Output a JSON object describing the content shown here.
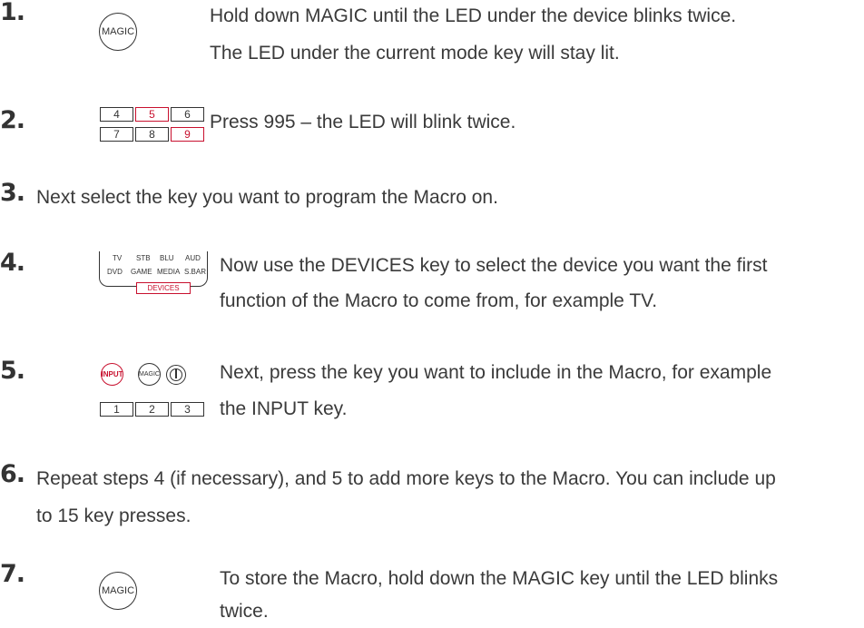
{
  "steps": [
    {
      "number": "1.",
      "lines": [
        "Hold down MAGIC until the LED under the device blinks twice.",
        "The LED under the current mode key will stay lit."
      ],
      "icon": {
        "magic_label": "MAGIC"
      }
    },
    {
      "number": "2.",
      "lines": [
        "Press 995 – the LED will blink twice."
      ],
      "keys": [
        "4",
        "5",
        "6",
        "7",
        "8",
        "9"
      ]
    },
    {
      "number": "3.",
      "lines": [
        "Next select the key you want to program the Macro on."
      ]
    },
    {
      "number": "4.",
      "lines": [
        "Now use the DEVICES key to select the device you want the first",
        "function of the Macro to come from, for example TV."
      ],
      "devices": {
        "row1": [
          "TV",
          "STB",
          "BLU",
          "AUD"
        ],
        "row2": [
          "DVD",
          "GAME",
          "MEDIA",
          "S.BAR"
        ],
        "button": "DEVICES"
      }
    },
    {
      "number": "5.",
      "lines": [
        "Next, press the key you want to include in the Macro, for example",
        "the INPUT key."
      ],
      "icons": {
        "input_label": "INPUT",
        "magic_label": "MAGIC"
      },
      "keys": [
        "1",
        "2",
        "3"
      ]
    },
    {
      "number": "6.",
      "lines": [
        "Repeat steps 4 (if necessary), and 5 to add more keys to the Macro. You can include up",
        "to 15 key presses."
      ]
    },
    {
      "number": "7.",
      "lines": [
        "To store the Macro, hold down the MAGIC key until the LED blinks",
        "twice."
      ],
      "icon": {
        "magic_label": "MAGIC"
      }
    }
  ],
  "colors": {
    "text": "#3a3a3a",
    "accent": "#c8102e"
  }
}
